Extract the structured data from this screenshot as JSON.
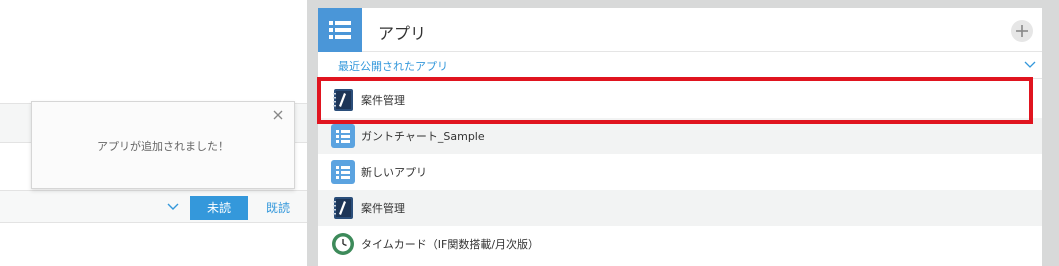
{
  "toast": {
    "message": "アプリが追加されました！"
  },
  "filter": {
    "unread_label": "未読",
    "read_label": "既読"
  },
  "apps_panel": {
    "title": "アプリ",
    "section_label": "最近公開されたアプリ",
    "items": [
      {
        "label": "案件管理",
        "icon": "notebook-icon"
      },
      {
        "label": "ガントチャート_Sample",
        "icon": "list-app-icon"
      },
      {
        "label": "新しいアプリ",
        "icon": "list-app-icon"
      },
      {
        "label": "案件管理",
        "icon": "notebook-icon"
      },
      {
        "label": "タイムカード（IF関数搭載/月次版）",
        "icon": "clock-icon"
      }
    ]
  },
  "colors": {
    "accent": "#3498db",
    "highlight": "#e0141f",
    "app_icon": "#4a96d8"
  }
}
